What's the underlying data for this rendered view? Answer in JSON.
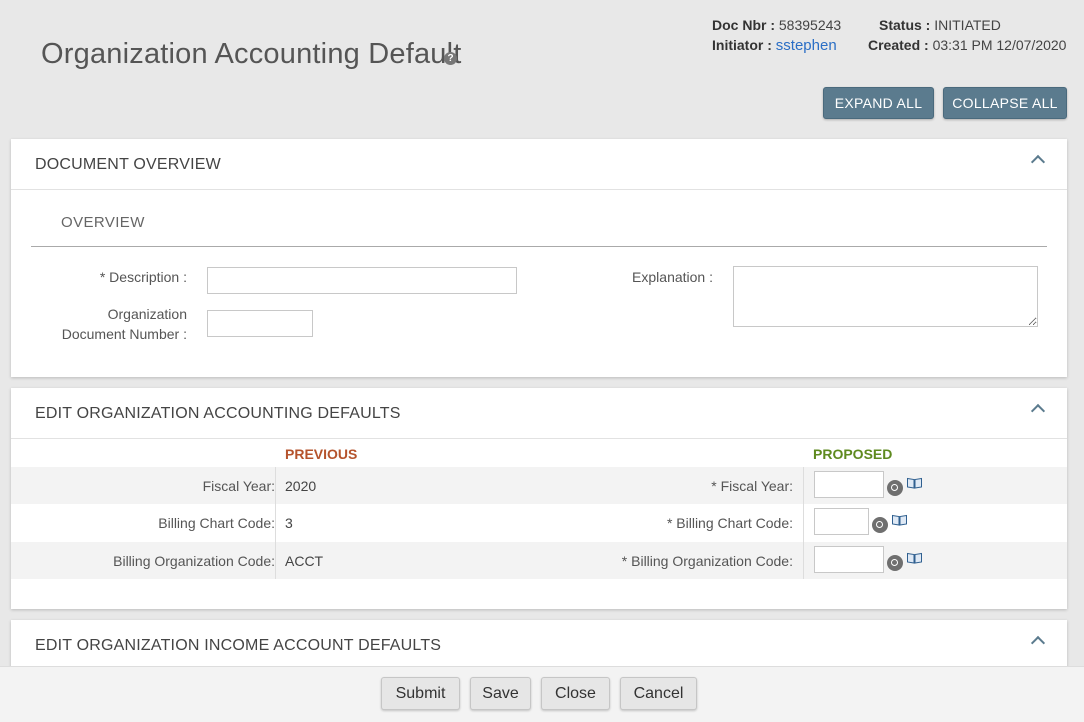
{
  "header": {
    "title": "Organization Accounting Default",
    "help_glyph": "?",
    "doc_nbr_label": "Doc Nbr :",
    "doc_nbr": "58395243",
    "initiator_label": "Initiator :",
    "initiator": "sstephen",
    "status_label": "Status :",
    "status": "INITIATED",
    "created_label": "Created :",
    "created": "03:31 PM 12/07/2020",
    "expand_all": "EXPAND ALL",
    "collapse_all": "COLLAPSE ALL"
  },
  "document_overview": {
    "title": "DOCUMENT OVERVIEW",
    "subtitle": "OVERVIEW",
    "description_label": "* Description :",
    "description_value": "",
    "org_doc_number_label_1": "Organization",
    "org_doc_number_label_2": "Document Number :",
    "org_doc_number_value": "",
    "explanation_label": "Explanation :",
    "explanation_value": ""
  },
  "accounting_defaults": {
    "title": "EDIT ORGANIZATION ACCOUNTING DEFAULTS",
    "previous_header": "PREVIOUS",
    "proposed_header": "PROPOSED",
    "rows": [
      {
        "label": "Fiscal Year:",
        "previous": "2020",
        "proposed_label": "* Fiscal Year:",
        "proposed": ""
      },
      {
        "label": "Billing Chart Code:",
        "previous": "3",
        "proposed_label": "* Billing Chart Code:",
        "proposed": ""
      },
      {
        "label": "Billing Organization Code:",
        "previous": "ACCT",
        "proposed_label": "* Billing Organization Code:",
        "proposed": ""
      }
    ]
  },
  "income_defaults": {
    "title": "EDIT ORGANIZATION INCOME ACCOUNT DEFAULTS"
  },
  "footer": {
    "submit": "Submit",
    "save": "Save",
    "close": "Close",
    "cancel": "Cancel"
  },
  "colors": {
    "previous": "#b5532c",
    "proposed": "#5e8a1f",
    "accent_button": "#5b7b8e",
    "link": "#2a6ec5"
  }
}
